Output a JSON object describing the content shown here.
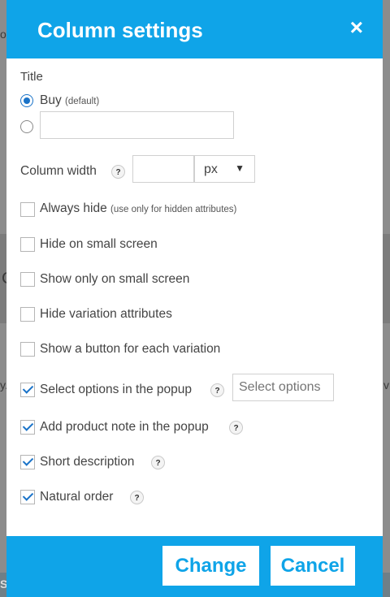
{
  "dialog": {
    "title": "Column settings",
    "close_icon": "×"
  },
  "title_section": {
    "label": "Title",
    "option_default": "Buy",
    "option_default_note": "(default)",
    "custom_value": "",
    "selected": "default"
  },
  "column_width": {
    "label": "Column width",
    "help": "?",
    "value": "",
    "unit": "px",
    "unit_arrow": "▼"
  },
  "options": [
    {
      "label": "Always hide",
      "note": "(use only for hidden attributes)",
      "checked": false
    },
    {
      "label": "Hide on small screen",
      "checked": false
    },
    {
      "label": "Show only on small screen",
      "checked": false
    },
    {
      "label": "Hide variation attributes",
      "checked": false
    },
    {
      "label": "Show a button for each variation",
      "checked": false
    },
    {
      "label": "Select options in the popup",
      "checked": true,
      "help": "?",
      "input_placeholder": "Select options"
    },
    {
      "label": "Add product note in the popup",
      "checked": true,
      "help": "?"
    },
    {
      "label": "Short description",
      "checked": true,
      "help": "?"
    },
    {
      "label": "Natural order",
      "checked": true,
      "help": "?"
    }
  ],
  "footer": {
    "change_label": "Change",
    "cancel_label": "Cancel"
  },
  "background": {
    "frag_left_1": "ol",
    "frag_left_2": "C",
    "frag_left_3": "y.",
    "frag_right_1": "v",
    "frag_bottom": "S"
  },
  "colors": {
    "accent": "#0fa4e8",
    "checkmark": "#1a73c8"
  }
}
